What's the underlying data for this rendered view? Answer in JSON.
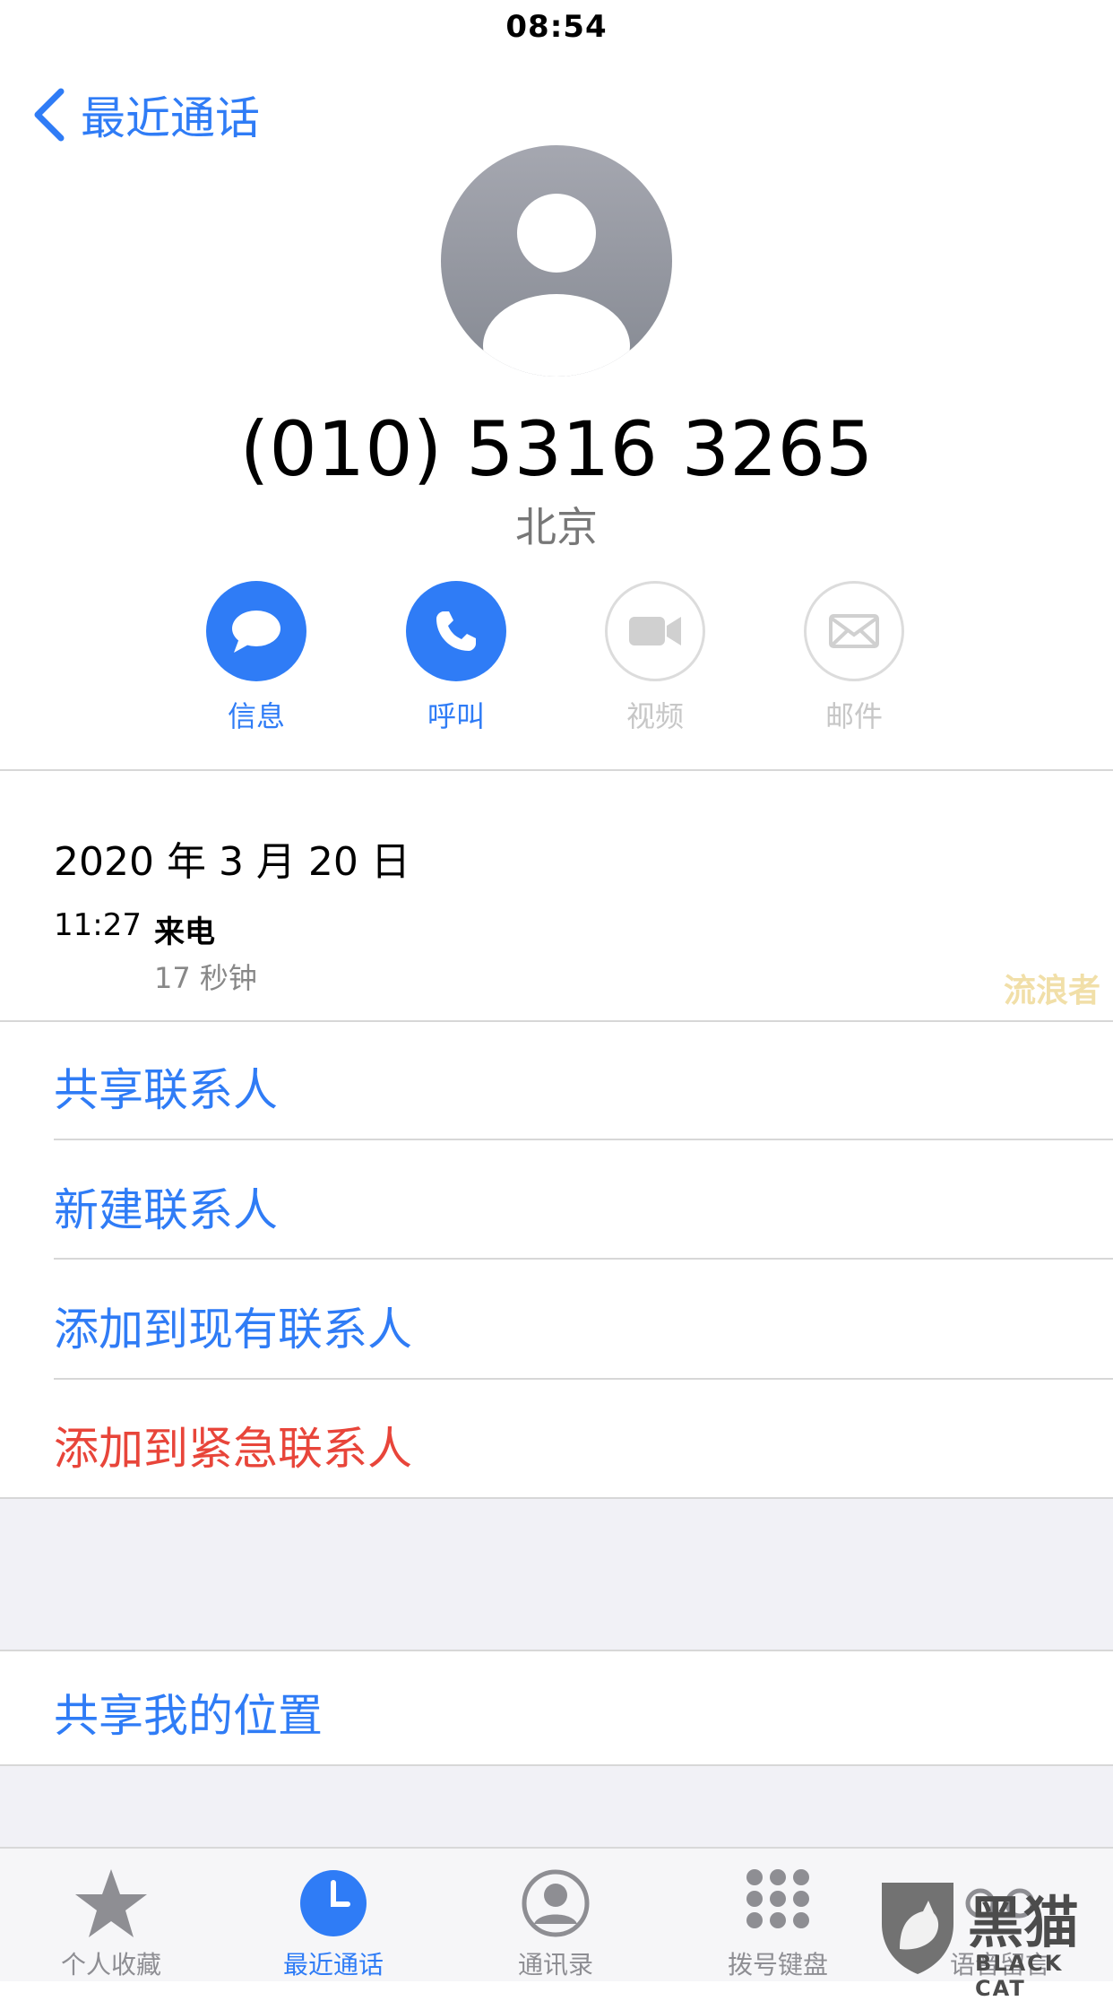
{
  "status_bar": {
    "time": "08:54"
  },
  "nav": {
    "back_label": "最近通话"
  },
  "contact": {
    "number": "(010) 5316 3265",
    "location": "北京"
  },
  "actions": [
    {
      "label": "信息",
      "icon": "message-icon",
      "enabled": true
    },
    {
      "label": "呼叫",
      "icon": "phone-icon",
      "enabled": true
    },
    {
      "label": "视频",
      "icon": "video-icon",
      "enabled": false
    },
    {
      "label": "邮件",
      "icon": "mail-icon",
      "enabled": false
    }
  ],
  "call_log": {
    "date": "2020 年 3 月 20 日",
    "time": "11:27",
    "type": "来电",
    "duration": "17 秒钟"
  },
  "watermark": "流浪者",
  "options": {
    "share_contact": "共享联系人",
    "new_contact": "新建联系人",
    "add_existing": "添加到现有联系人",
    "add_emergency": "添加到紧急联系人",
    "share_location": "共享我的位置"
  },
  "tabs": [
    {
      "label": "个人收藏",
      "icon": "star-icon",
      "active": false
    },
    {
      "label": "最近通话",
      "icon": "clock-icon",
      "active": true
    },
    {
      "label": "通讯录",
      "icon": "contacts-icon",
      "active": false
    },
    {
      "label": "拨号键盘",
      "icon": "keypad-icon",
      "active": false
    },
    {
      "label": "语音留言",
      "icon": "voicemail-icon",
      "active": false
    }
  ],
  "logo": {
    "text": "黑猫",
    "subtext": "BLACK CAT"
  },
  "colors": {
    "accent": "#2f7cf6",
    "danger": "#e8453a",
    "disabled": "#c7c7c7"
  }
}
